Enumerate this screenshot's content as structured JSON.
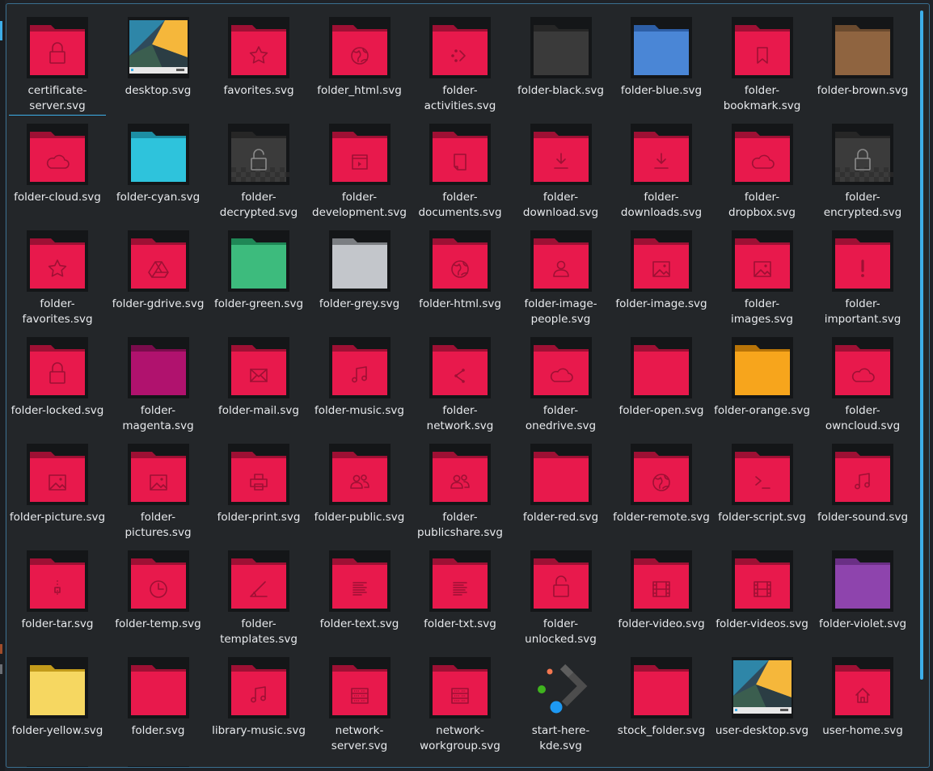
{
  "colors": {
    "folder_red": "#e8194c",
    "folder_red_tab": "#9e1034",
    "selection_accent": "#3daee9",
    "background": "#232629"
  },
  "items": [
    {
      "name": "certificate-server.svg",
      "type": "folder",
      "color": "red",
      "glyph": "lock"
    },
    {
      "name": "desktop.svg",
      "type": "desktop"
    },
    {
      "name": "favorites.svg",
      "type": "folder",
      "color": "red",
      "glyph": "star"
    },
    {
      "name": "folder_html.svg",
      "type": "folder",
      "color": "red",
      "glyph": "globe"
    },
    {
      "name": "folder-activities.svg",
      "type": "folder",
      "color": "red",
      "glyph": "activities"
    },
    {
      "name": "folder-black.svg",
      "type": "folder",
      "color": "black",
      "glyph": ""
    },
    {
      "name": "folder-blue.svg",
      "type": "folder",
      "color": "blue",
      "glyph": ""
    },
    {
      "name": "folder-bookmark.svg",
      "type": "folder",
      "color": "red",
      "glyph": "bookmark"
    },
    {
      "name": "folder-brown.svg",
      "type": "folder",
      "color": "brown",
      "glyph": ""
    },
    {
      "name": "folder-cloud.svg",
      "type": "folder",
      "color": "red",
      "glyph": "cloud"
    },
    {
      "name": "folder-cyan.svg",
      "type": "folder",
      "color": "cyan",
      "glyph": ""
    },
    {
      "name": "folder-decrypted.svg",
      "type": "folder",
      "color": "dark",
      "glyph": "unlock"
    },
    {
      "name": "folder-development.svg",
      "type": "folder",
      "color": "red",
      "glyph": "dev"
    },
    {
      "name": "folder-documents.svg",
      "type": "folder",
      "color": "red",
      "glyph": "doc"
    },
    {
      "name": "folder-download.svg",
      "type": "folder",
      "color": "red",
      "glyph": "download"
    },
    {
      "name": "folder-downloads.svg",
      "type": "folder",
      "color": "red",
      "glyph": "download"
    },
    {
      "name": "folder-dropbox.svg",
      "type": "folder",
      "color": "red",
      "glyph": "cloud"
    },
    {
      "name": "folder-encrypted.svg",
      "type": "folder",
      "color": "dark",
      "glyph": "lock"
    },
    {
      "name": "folder-favorites.svg",
      "type": "folder",
      "color": "red",
      "glyph": "star"
    },
    {
      "name": "folder-gdrive.svg",
      "type": "folder",
      "color": "red",
      "glyph": "gdrive"
    },
    {
      "name": "folder-green.svg",
      "type": "folder",
      "color": "green",
      "glyph": ""
    },
    {
      "name": "folder-grey.svg",
      "type": "folder",
      "color": "grey",
      "glyph": ""
    },
    {
      "name": "folder-html.svg",
      "type": "folder",
      "color": "red",
      "glyph": "globe"
    },
    {
      "name": "folder-image-people.svg",
      "type": "folder",
      "color": "red",
      "glyph": "person"
    },
    {
      "name": "folder-image.svg",
      "type": "folder",
      "color": "red",
      "glyph": "image"
    },
    {
      "name": "folder-images.svg",
      "type": "folder",
      "color": "red",
      "glyph": "image"
    },
    {
      "name": "folder-important.svg",
      "type": "folder",
      "color": "red",
      "glyph": "important"
    },
    {
      "name": "folder-locked.svg",
      "type": "folder",
      "color": "red",
      "glyph": "lock"
    },
    {
      "name": "folder-magenta.svg",
      "type": "folder",
      "color": "magenta",
      "glyph": ""
    },
    {
      "name": "folder-mail.svg",
      "type": "folder",
      "color": "red",
      "glyph": "mail"
    },
    {
      "name": "folder-music.svg",
      "type": "folder",
      "color": "red",
      "glyph": "music"
    },
    {
      "name": "folder-network.svg",
      "type": "folder",
      "color": "red",
      "glyph": "network"
    },
    {
      "name": "folder-onedrive.svg",
      "type": "folder",
      "color": "red",
      "glyph": "cloud"
    },
    {
      "name": "folder-open.svg",
      "type": "folder",
      "color": "red",
      "glyph": ""
    },
    {
      "name": "folder-orange.svg",
      "type": "folder",
      "color": "orange",
      "glyph": ""
    },
    {
      "name": "folder-owncloud.svg",
      "type": "folder",
      "color": "red",
      "glyph": "cloud"
    },
    {
      "name": "folder-picture.svg",
      "type": "folder",
      "color": "red",
      "glyph": "image"
    },
    {
      "name": "folder-pictures.svg",
      "type": "folder",
      "color": "red",
      "glyph": "image"
    },
    {
      "name": "folder-print.svg",
      "type": "folder",
      "color": "red",
      "glyph": "print"
    },
    {
      "name": "folder-public.svg",
      "type": "folder",
      "color": "red",
      "glyph": "people"
    },
    {
      "name": "folder-publicshare.svg",
      "type": "folder",
      "color": "red",
      "glyph": "people"
    },
    {
      "name": "folder-red.svg",
      "type": "folder",
      "color": "red",
      "glyph": ""
    },
    {
      "name": "folder-remote.svg",
      "type": "folder",
      "color": "red",
      "glyph": "globe"
    },
    {
      "name": "folder-script.svg",
      "type": "folder",
      "color": "red",
      "glyph": "script"
    },
    {
      "name": "folder-sound.svg",
      "type": "folder",
      "color": "red",
      "glyph": "music"
    },
    {
      "name": "folder-tar.svg",
      "type": "folder",
      "color": "red",
      "glyph": "tar"
    },
    {
      "name": "folder-temp.svg",
      "type": "folder",
      "color": "red",
      "glyph": "clock"
    },
    {
      "name": "folder-templates.svg",
      "type": "folder",
      "color": "red",
      "glyph": "templates"
    },
    {
      "name": "folder-text.svg",
      "type": "folder",
      "color": "red",
      "glyph": "text"
    },
    {
      "name": "folder-txt.svg",
      "type": "folder",
      "color": "red",
      "glyph": "text"
    },
    {
      "name": "folder-unlocked.svg",
      "type": "folder",
      "color": "red",
      "glyph": "unlock"
    },
    {
      "name": "folder-video.svg",
      "type": "folder",
      "color": "red",
      "glyph": "film"
    },
    {
      "name": "folder-videos.svg",
      "type": "folder",
      "color": "red",
      "glyph": "film"
    },
    {
      "name": "folder-violet.svg",
      "type": "folder",
      "color": "violet",
      "glyph": ""
    },
    {
      "name": "folder-yellow.svg",
      "type": "folder",
      "color": "yellow",
      "glyph": ""
    },
    {
      "name": "folder.svg",
      "type": "folder",
      "color": "red",
      "glyph": ""
    },
    {
      "name": "library-music.svg",
      "type": "folder",
      "color": "red",
      "glyph": "music"
    },
    {
      "name": "network-server.svg",
      "type": "folder",
      "color": "red",
      "glyph": "server"
    },
    {
      "name": "network-workgroup.svg",
      "type": "folder",
      "color": "red",
      "glyph": "server"
    },
    {
      "name": "start-here-kde.svg",
      "type": "kde"
    },
    {
      "name": "stock_folder.svg",
      "type": "folder",
      "color": "red",
      "glyph": ""
    },
    {
      "name": "user-desktop.svg",
      "type": "desktop"
    },
    {
      "name": "user-home.svg",
      "type": "folder",
      "color": "red",
      "glyph": "home"
    }
  ],
  "partial_row": [
    "magenta-tab",
    "magenta-tab"
  ]
}
